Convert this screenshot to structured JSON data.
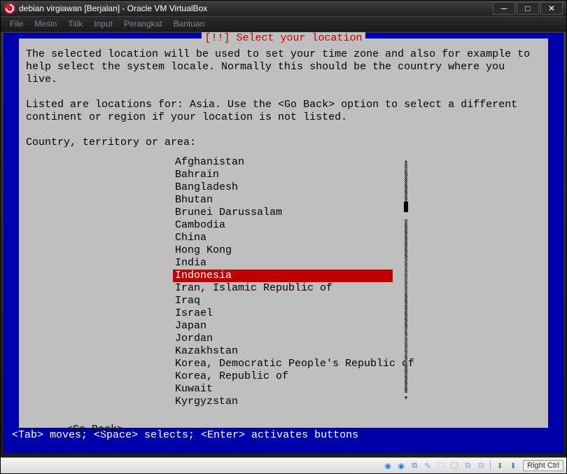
{
  "window": {
    "title": "debian virgiawan [Berjalan] - Oracle VM VirtualBox"
  },
  "menubar": {
    "items": [
      "File",
      "Mesin",
      "Tilik",
      "Input",
      "Perangkat",
      "Bantuan"
    ]
  },
  "installer": {
    "box_title": "[!!] Select your location",
    "paragraph1": "The selected location will be used to set your time zone and also for example to help select the system locale. Normally this should be the country where you live.",
    "paragraph2": "Listed are locations for: Asia. Use the <Go Back> option to select a different continent or region if your location is not listed.",
    "prompt": "Country, territory or area:",
    "countries": [
      {
        "label": "Afghanistan",
        "selected": false
      },
      {
        "label": "Bahrain",
        "selected": false
      },
      {
        "label": "Bangladesh",
        "selected": false
      },
      {
        "label": "Bhutan",
        "selected": false
      },
      {
        "label": "Brunei Darussalam",
        "selected": false
      },
      {
        "label": "Cambodia",
        "selected": false
      },
      {
        "label": "China",
        "selected": false
      },
      {
        "label": "Hong Kong",
        "selected": false
      },
      {
        "label": "India",
        "selected": false
      },
      {
        "label": "Indonesia",
        "selected": true
      },
      {
        "label": "Iran, Islamic Republic of",
        "selected": false
      },
      {
        "label": "Iraq",
        "selected": false
      },
      {
        "label": "Israel",
        "selected": false
      },
      {
        "label": "Japan",
        "selected": false
      },
      {
        "label": "Jordan",
        "selected": false
      },
      {
        "label": "Kazakhstan",
        "selected": false
      },
      {
        "label": "Korea, Democratic People's Republic of",
        "selected": false
      },
      {
        "label": "Korea, Republic of",
        "selected": false
      },
      {
        "label": "Kuwait",
        "selected": false
      },
      {
        "label": "Kyrgyzstan",
        "selected": false
      }
    ],
    "go_back": "<Go Back>"
  },
  "bottom_hint": "<Tab> moves; <Space> selects; <Enter> activates buttons",
  "statusbar": {
    "hostkey": "Right Ctrl"
  }
}
